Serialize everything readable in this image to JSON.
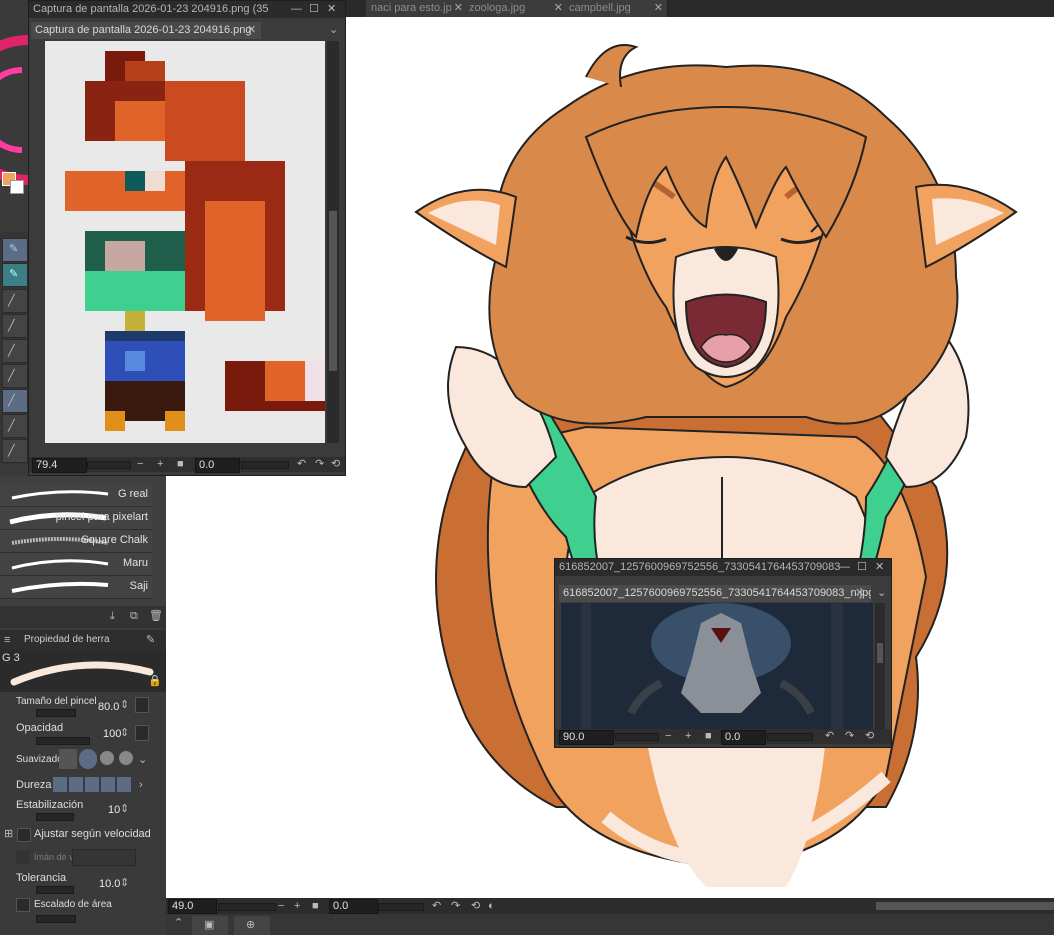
{
  "top_tabs": {
    "items": [
      {
        "label": "naci para esto.jp"
      },
      {
        "label": "zoologa.jpg"
      },
      {
        "label": "campbell.jpg"
      }
    ],
    "close_glyph": "✕"
  },
  "subview1": {
    "window_title": "Captura de pantalla 2026-01-23 204916.png (35",
    "tab_label": "Captura de pantalla 2026-01-23 204916.png",
    "zoom": "79.4",
    "angle": "0.0"
  },
  "subview2": {
    "window_title": "616852007_1257600969752556_7330541764453709083",
    "tab_label": "616852007_1257600969752556_7330541764453709083_n.jpg",
    "zoom": "90.0",
    "angle": "0.0"
  },
  "brushes": [
    {
      "label": "G real"
    },
    {
      "label": "pincel para pixelart"
    },
    {
      "label": "Square Chalk"
    },
    {
      "label": "Maru"
    },
    {
      "label": "Saji"
    }
  ],
  "tool_property": {
    "header": "Propiedad de herra",
    "preset_name": "G 3",
    "brush_size_label": "Tamaño del pincel",
    "brush_size": "80.0",
    "opacity_label": "Opacidad",
    "opacity": "100",
    "smoothing_label": "Suavizado",
    "hardness_label": "Dureza",
    "stabilization_label": "Estabilización",
    "stabilization": "10",
    "speed_adjust_label": "Ajustar según velocidad",
    "snap_label": "Imán de v",
    "tolerance_label": "Tolerancia",
    "tolerance": "10.0",
    "area_scale_label": "Escalado de área"
  },
  "canvas_status": {
    "zoom": "49.0",
    "angle": "0.0"
  },
  "colors": {
    "fur_main": "#d98a4a",
    "fur_light": "#f2a25f",
    "fur_dark": "#b56330",
    "cream": "#fbe8dc",
    "shirt_green": "#3fcf8e",
    "mouth": "#7a2a33",
    "tongue": "#e8a0a8",
    "accent_blue": "#5b6c84"
  }
}
